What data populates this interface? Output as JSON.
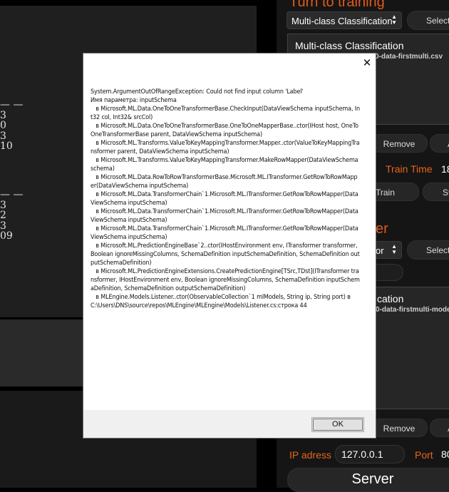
{
  "background_app": {
    "left_numbers_top": [
      "— —",
      "3",
      "0",
      "3",
      "10"
    ],
    "left_numbers_bottom": [
      "— —",
      "3",
      "2",
      "3",
      "09"
    ],
    "train_section": {
      "title": "Turn to training",
      "type_select_value": "Multi-class Classification",
      "select_button_label": "Select",
      "list_item_title": "Multi-class Classification",
      "list_item_subtitle": "0-data-firstmulti.csv",
      "remove_button_label": "Remove",
      "more_button_label": "A",
      "train_time_label": "Train Time",
      "train_time_value": "18",
      "train_button_label": "Train",
      "stop_button_label": "St"
    },
    "predict_section": {
      "title": "er",
      "type_select_value": "or",
      "select_button_label": "Select",
      "list_item_title": "cation",
      "list_item_subtitle": "0-data-firstmulti-mode",
      "remove_button_label": "Remove",
      "more_button_label": "A"
    },
    "server_section": {
      "ip_label": "IP adress",
      "ip_value": "127.0.0.1",
      "port_label": "Port",
      "port_value": "80",
      "server_button_label": "Server"
    }
  },
  "dialog": {
    "close_glyph": "✕",
    "message": "System.ArgumentOutOfRangeException: Could not find input column 'Label'\nИмя параметра: inputSchema\n   в Microsoft.ML.Data.OneToOneTransformerBase.CheckInput(DataViewSchema inputSchema, Int32 col, Int32& srcCol)\n   в Microsoft.ML.Data.OneToOneTransformerBase.OneToOneMapperBase..ctor(IHost host, OneToOneTransformerBase parent, DataViewSchema inputSchema)\n   в Microsoft.ML.Transforms.ValueToKeyMappingTransformer.Mapper..ctor(ValueToKeyMappingTransformer parent, DataViewSchema inputSchema)\n   в Microsoft.ML.Transforms.ValueToKeyMappingTransformer.MakeRowMapper(DataViewSchema schema)\n   в Microsoft.ML.Data.RowToRowTransformerBase.Microsoft.ML.ITransformer.GetRowToRowMapper(DataViewSchema inputSchema)\n   в Microsoft.ML.Data.TransformerChain`1.Microsoft.ML.ITransformer.GetRowToRowMapper(DataViewSchema inputSchema)\n   в Microsoft.ML.Data.TransformerChain`1.Microsoft.ML.ITransformer.GetRowToRowMapper(DataViewSchema inputSchema)\n   в Microsoft.ML.Data.TransformerChain`1.Microsoft.ML.ITransformer.GetRowToRowMapper(DataViewSchema inputSchema)\n   в Microsoft.ML.PredictionEngineBase`2..ctor(IHostEnvironment env, ITransformer transformer, Boolean ignoreMissingColumns, SchemaDefinition inputSchemaDefinition, SchemaDefinition outputSchemaDefinition)\n   в Microsoft.ML.PredictionEngineExtensions.CreatePredictionEngine[TSrc,TDst](ITransformer transformer, IHostEnvironment env, Boolean ignoreMissingColumns, SchemaDefinition inputSchemaDefinition, SchemaDefinition outputSchemaDefinition)\n   в MLEngine.Models.Listener..ctor(ObservableCollection`1 mlModels, String ip, String port) в C:\\Users\\DNS\\source\\repos\\MLEngine\\MLEngine\\Models\\Listener.cs:строка 44",
    "ok_label": "OK"
  }
}
